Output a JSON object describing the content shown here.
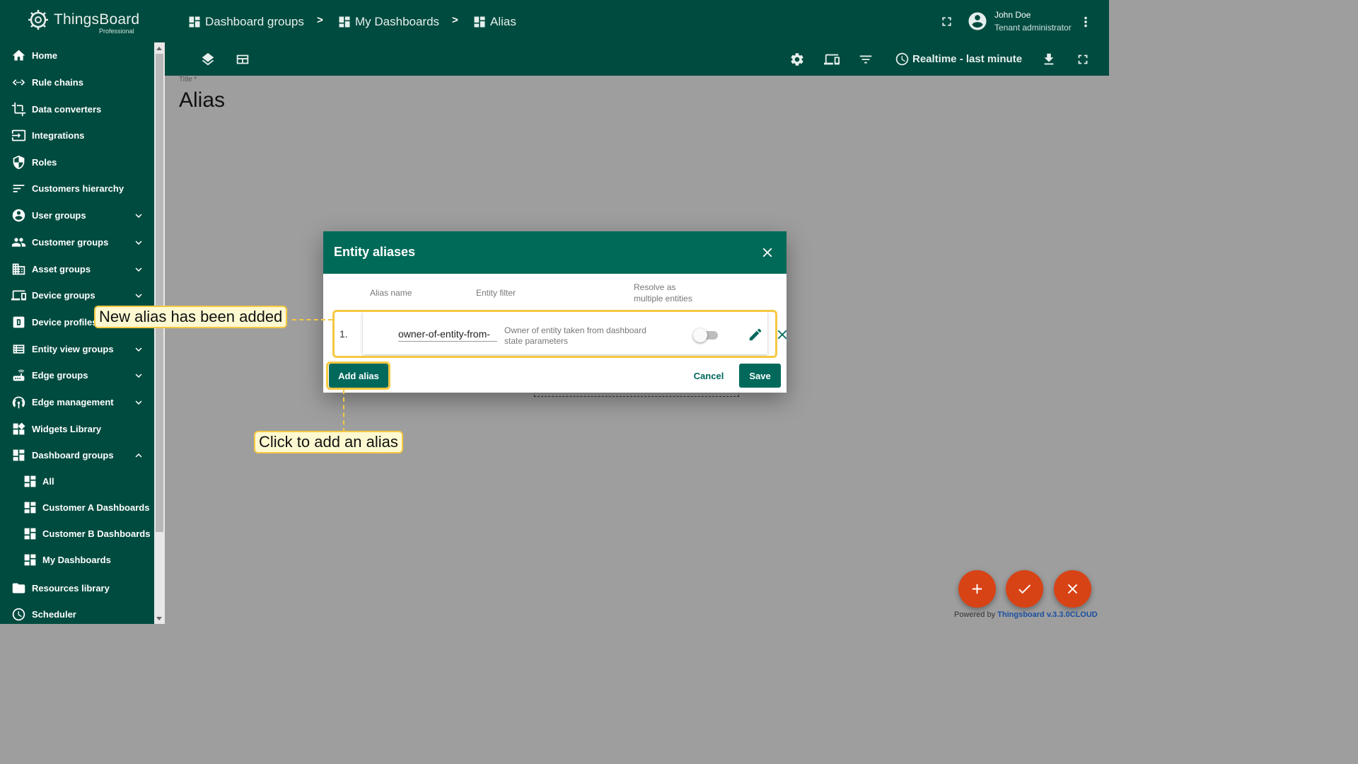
{
  "logo": {
    "title": "ThingsBoard",
    "subtitle": "Professional"
  },
  "sidebar": {
    "items": [
      {
        "label": "Home",
        "icon": "home-icon"
      },
      {
        "label": "Rule chains",
        "icon": "rule-chains-icon"
      },
      {
        "label": "Data converters",
        "icon": "converter-icon"
      },
      {
        "label": "Integrations",
        "icon": "integrations-icon"
      },
      {
        "label": "Roles",
        "icon": "shield-icon"
      },
      {
        "label": "Customers hierarchy",
        "icon": "hierarchy-icon"
      },
      {
        "label": "User groups",
        "icon": "account-icon"
      },
      {
        "label": "Customer groups",
        "icon": "group-icon"
      },
      {
        "label": "Asset groups",
        "icon": "building-icon"
      },
      {
        "label": "Device groups",
        "icon": "devices-icon"
      },
      {
        "label": "Device profiles",
        "icon": "device-profile-icon"
      },
      {
        "label": "Entity view groups",
        "icon": "view-list-icon"
      },
      {
        "label": "Edge groups",
        "icon": "router-icon"
      },
      {
        "label": "Edge management",
        "icon": "antenna-icon"
      },
      {
        "label": "Widgets Library",
        "icon": "widgets-icon"
      },
      {
        "label": "Dashboard groups",
        "icon": "dashboard-icon"
      },
      {
        "label": "All",
        "icon": "dashboard-icon"
      },
      {
        "label": "Customer A Dashboards",
        "icon": "dashboard-icon"
      },
      {
        "label": "Customer B Dashboards",
        "icon": "dashboard-icon"
      },
      {
        "label": "My Dashboards",
        "icon": "dashboard-icon"
      },
      {
        "label": "Resources library",
        "icon": "folder-icon"
      },
      {
        "label": "Scheduler",
        "icon": "clock-icon"
      }
    ]
  },
  "breadcrumb": {
    "items": [
      "Dashboard groups",
      "My Dashboards",
      "Alias"
    ],
    "separator": ">"
  },
  "user": {
    "name": "John Doe",
    "role": "Tenant administrator"
  },
  "toolbar": {
    "timewindow": "Realtime - last minute"
  },
  "dashboard": {
    "title_label": "Title *",
    "title": "Alias"
  },
  "dialog": {
    "title": "Entity aliases",
    "columns": {
      "alias_name": "Alias name",
      "entity_filter": "Entity filter",
      "resolve_line1": "Resolve as",
      "resolve_line2": "multiple entities"
    },
    "rows": [
      {
        "index": "1.",
        "alias_name": "owner-of-entity-from-",
        "filter_line1": "Owner of entity taken from dashboard",
        "filter_line2": "state parameters",
        "resolve_multiple": false
      }
    ],
    "add_button": "Add alias",
    "cancel_button": "Cancel",
    "save_button": "Save"
  },
  "annotations": {
    "row_callout": "New alias has been added",
    "button_callout": "Click to add an alias"
  },
  "footer": {
    "powered_prefix": "Powered by",
    "powered_link": "Thingsboard v.3.3.0CLOUD"
  },
  "colors": {
    "primary": "#004b3f",
    "dialog_header": "#006a58",
    "accent": "#00695c",
    "fab": "#d84315",
    "highlight": "#f5c842"
  }
}
